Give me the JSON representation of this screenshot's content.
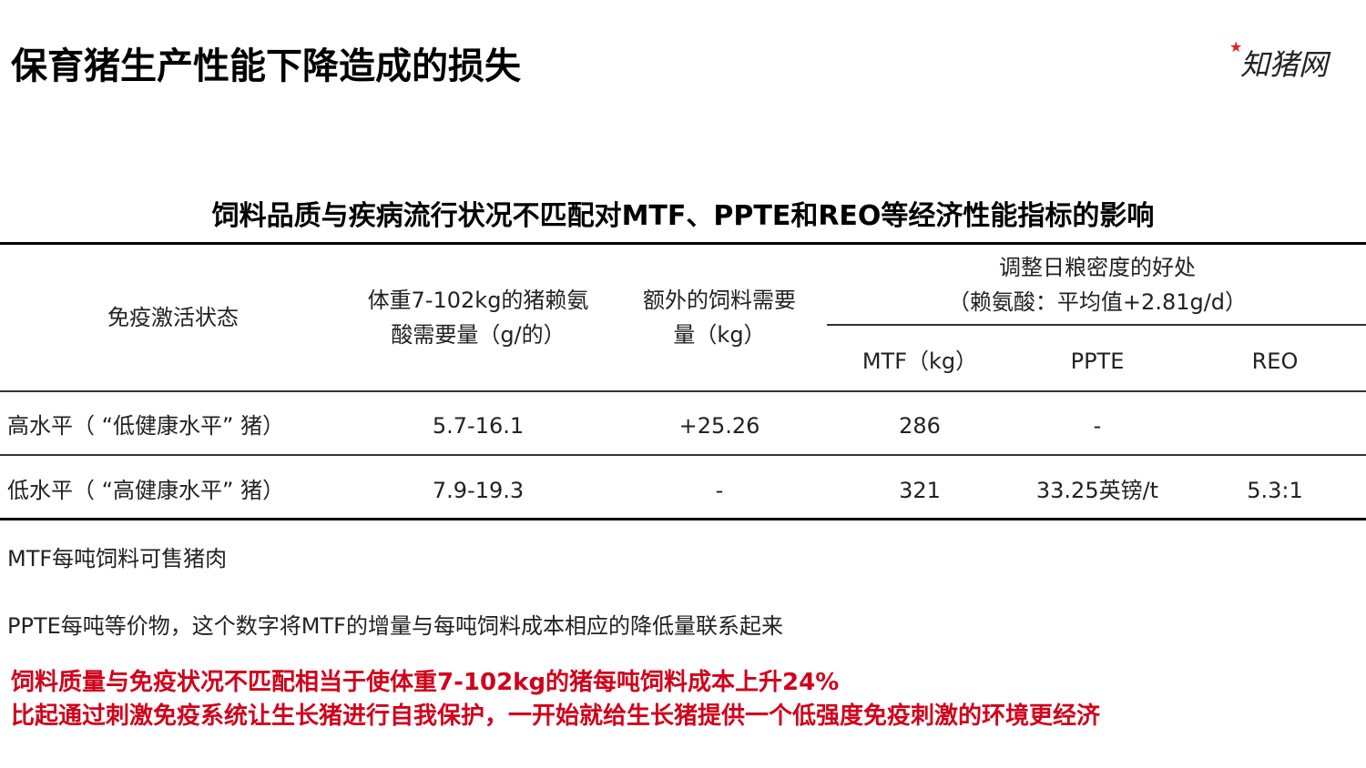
{
  "title": "保育猪生产性能下降造成的损失",
  "logo": {
    "text": "知猪网",
    "icon": "star-icon"
  },
  "table": {
    "caption": "饲料品质与疾病流行状况不匹配对MTF、PPTE和REO等经济性能指标的影响",
    "headers": {
      "col1": "免疫激活状态",
      "col2_line1": "体重7-102kg的猪赖氨",
      "col2_line2": "酸需要量（g/的）",
      "col3_line1": "额外的饲料需要",
      "col3_line2": "量（kg）",
      "group_line1": "调整日粮密度的好处",
      "group_line2": "（赖氨酸：平均值+2.81g/d）",
      "sub1": "MTF（kg）",
      "sub2": "PPTE",
      "sub3": "REO"
    },
    "rows": [
      {
        "state": "高水平（ “低健康水平” 猪）",
        "lysine": "5.7-16.1",
        "extra_feed": "+25.26",
        "mtf": "286",
        "ppte": "-",
        "reo": ""
      },
      {
        "state": "低水平（ “高健康水平” 猪）",
        "lysine": "7.9-19.3",
        "extra_feed": "-",
        "mtf": "321",
        "ppte": "33.25英镑/t",
        "reo": "5.3:1"
      }
    ]
  },
  "notes": {
    "mtf": "MTF每吨饲料可售猪肉",
    "ppte": "PPTE每吨等价物，这个数字将MTF的增量与每吨饲料成本相应的降低量联系起来"
  },
  "conclusions": {
    "line1": "饲料质量与免疫状况不匹配相当于使体重7-102kg的猪每吨饲料成本上升24%",
    "line2": "比起通过刺激免疫系统让生长猪进行自我保护，一开始就给生长猪提供一个低强度免疫刺激的环境更经济"
  },
  "colors": {
    "accent": "#d0021b",
    "text": "#222222"
  }
}
